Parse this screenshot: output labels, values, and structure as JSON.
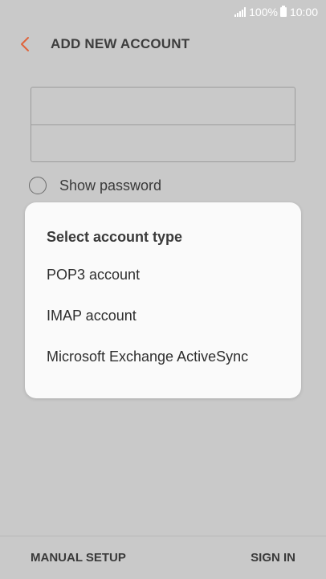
{
  "status_bar": {
    "battery_percent": "100%",
    "time": "10:00"
  },
  "header": {
    "title": "ADD NEW ACCOUNT",
    "back_icon": "chevron-left-icon",
    "accent_color": "#e0643c"
  },
  "form": {
    "show_password_label": "Show password",
    "show_password_checked": false
  },
  "dialog": {
    "title": "Select account type",
    "options": [
      {
        "label": "POP3 account"
      },
      {
        "label": "IMAP account"
      },
      {
        "label": "Microsoft Exchange ActiveSync"
      }
    ]
  },
  "footer": {
    "left_label": "MANUAL SETUP",
    "right_label": "SIGN IN"
  }
}
